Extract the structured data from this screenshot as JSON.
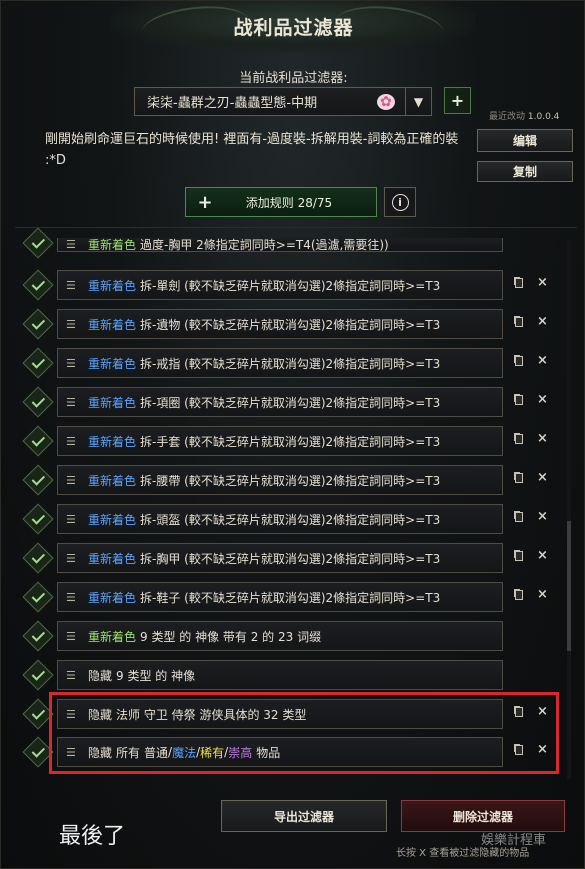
{
  "header": {
    "title": "战利品过滤器",
    "current_filter_label": "当前战利品过滤器:",
    "current_filter_value": "柒柒-蟲群之刃-蟲蟲型態-中期",
    "add_filter_label": "+",
    "recent_changes_label": "最近改动",
    "version": "1.0.0.4"
  },
  "description": "剛開始刷命運巨石的時候使用! 裡面有-過度裝-拆解用裝-詞較為正確的裝 :*D",
  "buttons": {
    "edit": "编辑",
    "copy": "复制",
    "add_rule": "添加规则 28/75",
    "add_rule_plus": "+",
    "info": "i",
    "export": "导出过滤器",
    "delete": "删除过滤器"
  },
  "rules": [
    {
      "keyword": "重新着色",
      "kw_color": "green",
      "text": "過度-胸甲 2條指定詞同時>=T4(過濾,需要往))"
    },
    {
      "keyword": "重新着色",
      "kw_color": "blue",
      "text": "拆-單劍 (較不缺乏碎片就取消勾選)2條指定詞同時>=T3"
    },
    {
      "keyword": "重新着色",
      "kw_color": "blue",
      "text": "拆-遺物 (較不缺乏碎片就取消勾選)2條指定詞同時>=T3"
    },
    {
      "keyword": "重新着色",
      "kw_color": "blue",
      "text": "拆-戒指 (較不缺乏碎片就取消勾選)2條指定詞同時>=T3"
    },
    {
      "keyword": "重新着色",
      "kw_color": "blue",
      "text": "拆-項圈 (較不缺乏碎片就取消勾選)2條指定詞同時>=T3"
    },
    {
      "keyword": "重新着色",
      "kw_color": "blue",
      "text": "拆-手套 (較不缺乏碎片就取消勾選)2條指定詞同時>=T3"
    },
    {
      "keyword": "重新着色",
      "kw_color": "blue",
      "text": "拆-腰帶 (較不缺乏碎片就取消勾選)2條指定詞同時>=T3"
    },
    {
      "keyword": "重新着色",
      "kw_color": "blue",
      "text": "拆-頭盔 (較不缺乏碎片就取消勾選)2條指定詞同時>=T3"
    },
    {
      "keyword": "重新着色",
      "kw_color": "blue",
      "text": "拆-胸甲 (較不缺乏碎片就取消勾選)2條指定詞同時>=T3"
    },
    {
      "keyword": "重新着色",
      "kw_color": "blue",
      "text": "拆-鞋子 (較不缺乏碎片就取消勾選)2條指定詞同時>=T3"
    },
    {
      "keyword": "重新着色",
      "kw_color": "green",
      "text": "9 类型 的 神像 带有 2 的 23 词缀"
    },
    {
      "keyword": "隐藏",
      "kw_color": "none",
      "text": "9 类型 的 神像"
    },
    {
      "keyword": "隐藏",
      "kw_color": "none",
      "text": " 法师 守卫 侍祭 游侠具体的 32 类型"
    }
  ],
  "last_rule": {
    "keyword": "隐藏",
    "prefix": "所有",
    "normal": "普通",
    "sep1": "/",
    "magic": "魔法",
    "sep2": "/",
    "rare": "稀有",
    "sep3": "/",
    "legend": "崇高",
    "suffix": "物品"
  },
  "footer": {
    "hint": "长按 X 查看被过滤隐藏的物品",
    "caption": "最後了",
    "watermark": "娛樂計程車"
  },
  "colors": {
    "blue_keyword": "#5aa3ff",
    "green_keyword": "#9be36a",
    "highlight": "#d9272e",
    "rare": "#f0e048",
    "legend": "#c07ce8"
  }
}
